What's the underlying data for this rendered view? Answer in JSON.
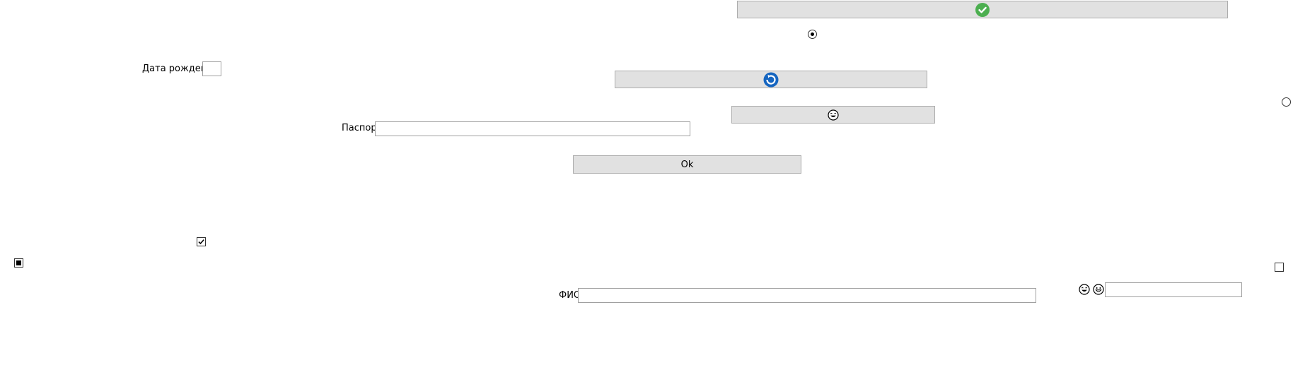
{
  "buttons": {
    "top_icon": "check-circle-icon",
    "refresh_icon": "refresh-icon",
    "emoji_icon": "smiling-face-icon",
    "ok_label": "Ok"
  },
  "fields": {
    "birth_date": {
      "label": "Дата рождения",
      "value": ""
    },
    "passport": {
      "label": "Паспорт",
      "value": ""
    },
    "full_name": {
      "label": "ФИО",
      "value": ""
    },
    "right_input": {
      "value": ""
    }
  },
  "radios": {
    "top_radio_checked": true,
    "right_radio_checked": false
  },
  "checkboxes": {
    "upper_checked": true,
    "left_indeterminate": true,
    "right_checked": false
  },
  "colors": {
    "button_bg": "#e1e1e1",
    "check_green": "#4caf50",
    "refresh_blue": "#1565c0"
  }
}
